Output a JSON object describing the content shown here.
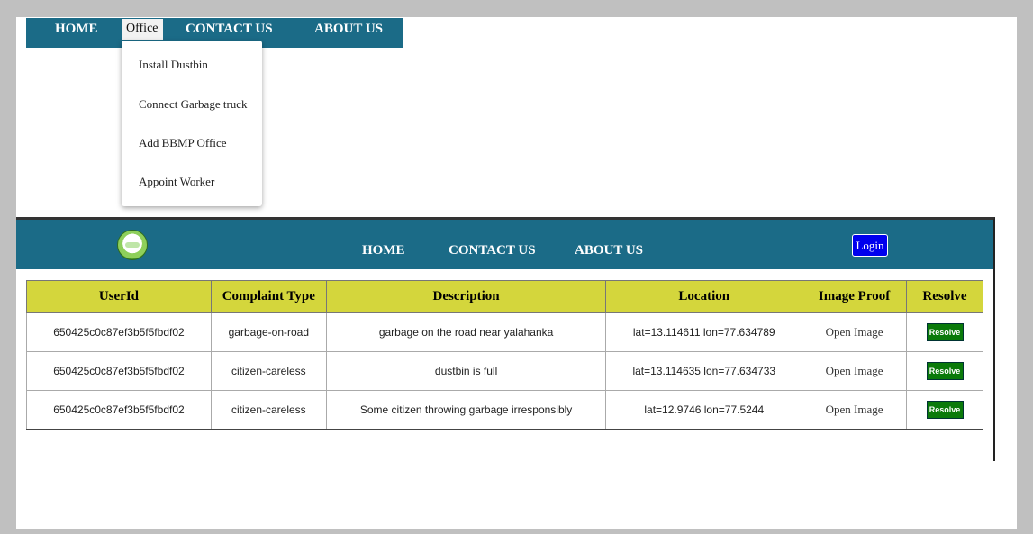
{
  "top_menu": {
    "home": "HOME",
    "office": "Office",
    "contact": "CONTACT US",
    "about": "ABOUT US",
    "office_dropdown": [
      "Install Dustbin",
      "Connect Garbage truck",
      "Add BBMP Office",
      "Appoint Worker"
    ]
  },
  "app_nav": {
    "home": "HOME",
    "contact": "CONTACT US",
    "about": "ABOUT US",
    "login": "Login"
  },
  "table": {
    "headers": [
      "UserId",
      "Complaint Type",
      "Description",
      "Location",
      "Image Proof",
      "Resolve"
    ],
    "rows": [
      {
        "userid": "650425c0c87ef3b5f5fbdf02",
        "type": "garbage-on-road",
        "description": "garbage on the road near yalahanka",
        "location": "lat=13.114611 lon=77.634789",
        "image": "Open Image",
        "resolve": "Resolve"
      },
      {
        "userid": "650425c0c87ef3b5f5fbdf02",
        "type": "citizen-careless",
        "description": "dustbin is full",
        "location": "lat=13.114635 lon=77.634733",
        "image": "Open Image",
        "resolve": "Resolve"
      },
      {
        "userid": "650425c0c87ef3b5f5fbdf02",
        "type": "citizen-careless",
        "description": "Some citizen throwing garbage irresponsibly",
        "location": "lat=12.9746 lon=77.5244",
        "image": "Open Image",
        "resolve": "Resolve"
      }
    ]
  },
  "colors": {
    "nav_bg": "#1b6b87",
    "header_yellow": "#d4d63c",
    "resolve_green": "#0a7a0a",
    "login_blue": "#0000ee"
  }
}
